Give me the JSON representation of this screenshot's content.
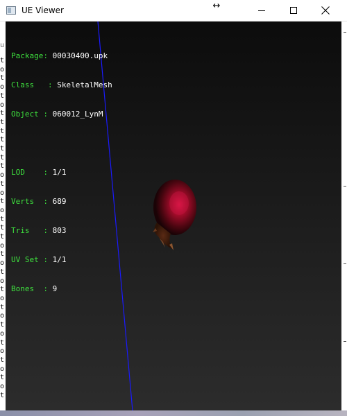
{
  "window": {
    "title": "UE Viewer",
    "buttons": {
      "minimize": "minimize",
      "maximize": "maximize",
      "close": "close"
    }
  },
  "background": {
    "left_column_letters": [
      "t",
      "o",
      "t",
      "o",
      "t",
      "o",
      "t",
      "t",
      "t",
      "t",
      "t",
      "t",
      "t",
      "o",
      "t",
      "o",
      "t",
      "o",
      "t",
      "t",
      "t",
      "o",
      "t",
      "o",
      "t",
      "o",
      "t",
      "o",
      "t",
      "o",
      "t",
      "o",
      "t",
      "o",
      "t",
      "o",
      "t",
      "o",
      "t"
    ],
    "top_fragment": "u"
  },
  "mesh_info": {
    "package_label": "Package",
    "package_value": "00030400.upk",
    "class_label": "Class",
    "class_value": "SkeletalMesh",
    "object_label": "Object",
    "object_value": "060012_LynM",
    "lod_label": "LOD",
    "lod_value": "1/1",
    "verts_label": "Verts",
    "verts_value": "689",
    "tris_label": "Tris",
    "tris_value": "803",
    "uvset_label": "UV Set",
    "uvset_value": "1/1",
    "bones_label": "Bones",
    "bones_value": "9"
  },
  "colors": {
    "label_green": "#3ee03e",
    "value_white": "#ffffff",
    "axis_blue": "#1a1aff",
    "mesh_red": "#b0102a"
  },
  "icons": {
    "app": "app-window-icon",
    "resize": "horizontal-resize-cursor-icon",
    "minimize": "minimize-icon",
    "maximize": "maximize-icon",
    "close": "close-icon"
  }
}
